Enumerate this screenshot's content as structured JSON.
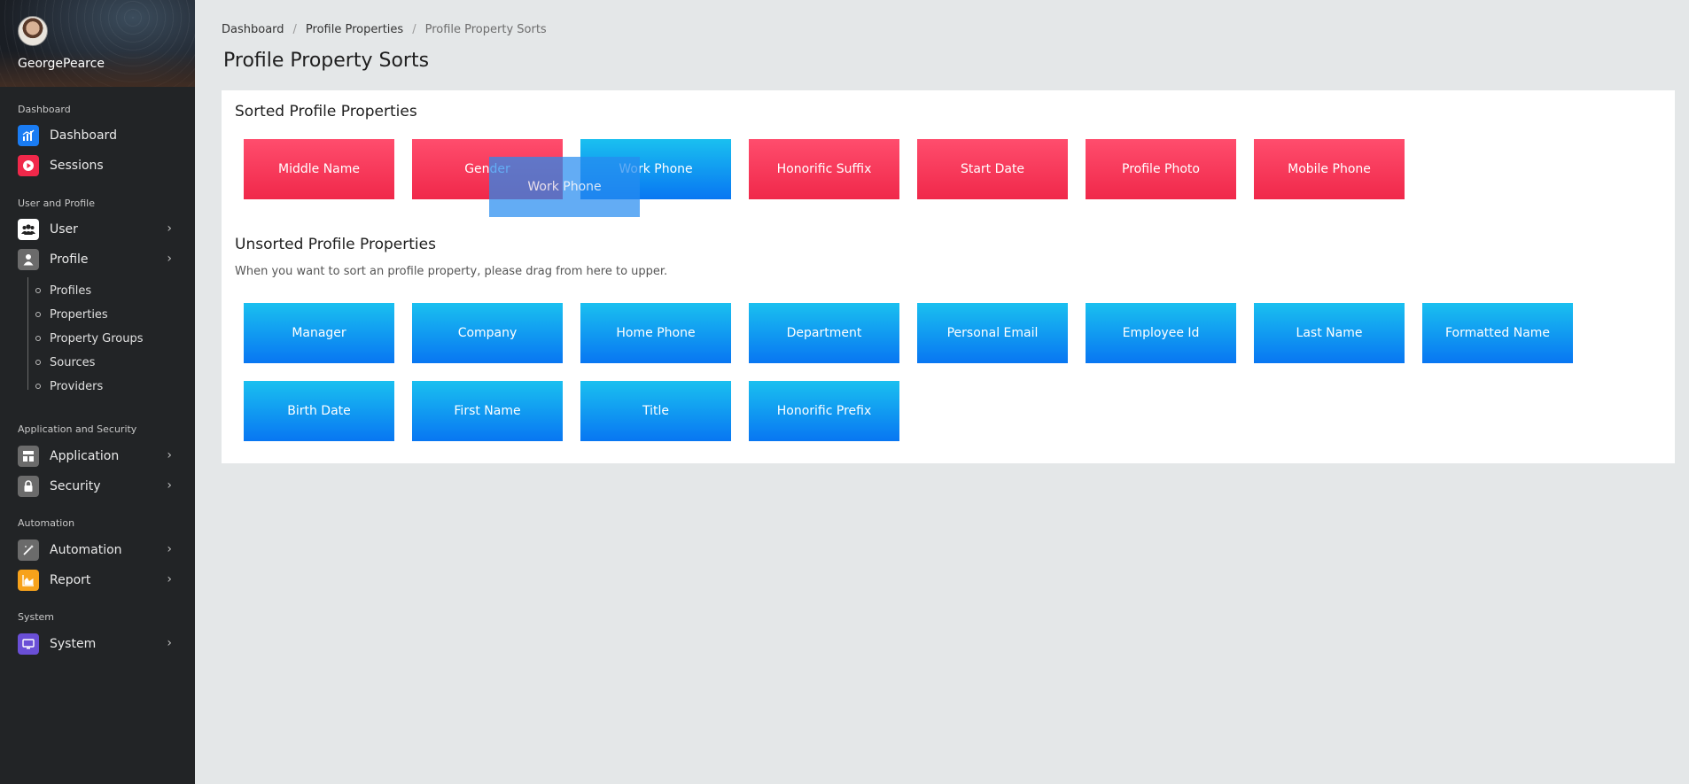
{
  "user": {
    "name": "GeorgePearce"
  },
  "sidebar": {
    "sections": [
      {
        "title": "Dashboard"
      },
      {
        "title": "User and Profile"
      },
      {
        "title": "Application and Security"
      },
      {
        "title": "Automation"
      },
      {
        "title": "System"
      }
    ],
    "items": {
      "dashboard": {
        "label": "Dashboard",
        "color": "#1a7cf3"
      },
      "sessions": {
        "label": "Sessions",
        "color": "#f0284a"
      },
      "user": {
        "label": "User",
        "color": "#ffffff"
      },
      "profile": {
        "label": "Profile",
        "color": "#6b6b6b"
      },
      "application": {
        "label": "Application",
        "color": "#6b6b6b"
      },
      "security": {
        "label": "Security",
        "color": "#6b6b6b"
      },
      "automation": {
        "label": "Automation",
        "color": "#6b6b6b"
      },
      "report": {
        "label": "Report",
        "color": "#f7a21b"
      },
      "system": {
        "label": "System",
        "color": "#6a4fd6"
      }
    },
    "profile_sub": [
      "Profiles",
      "Properties",
      "Property Groups",
      "Sources",
      "Providers"
    ]
  },
  "breadcrumb": [
    "Dashboard",
    "Profile Properties",
    "Profile Property Sorts"
  ],
  "page_title": "Profile Property Sorts",
  "sorted": {
    "title": "Sorted Profile Properties",
    "items": [
      "Middle Name",
      "Gender",
      "Work Phone",
      "Honorific Suffix",
      "Start Date",
      "Profile Photo",
      "Mobile Phone"
    ]
  },
  "dragging": {
    "label": "Work Phone"
  },
  "unsorted": {
    "title": "Unsorted Profile Properties",
    "description": "When you want to sort an profile property, please drag from here to upper.",
    "items": [
      "Manager",
      "Company",
      "Home Phone",
      "Department",
      "Personal Email",
      "Employee Id",
      "Last Name",
      "Formatted Name",
      "Birth Date",
      "First Name",
      "Title",
      "Honorific Prefix"
    ]
  },
  "colors": {
    "sorted": "#f0284a",
    "unsorted": "#0876f2",
    "sidebar": "#222426"
  }
}
